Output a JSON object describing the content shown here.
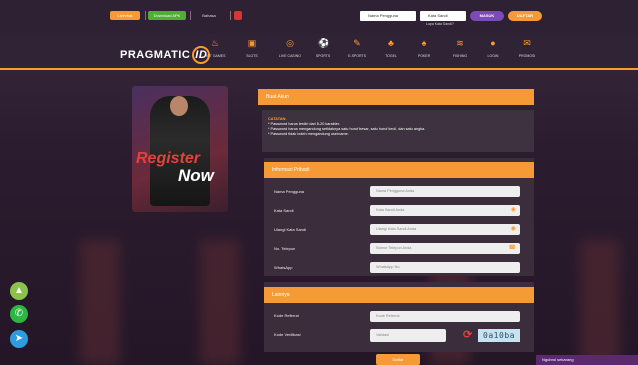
{
  "header": {
    "btn_one": "Livechat",
    "btn_two": "Download APK",
    "lang_label": "Bahasa",
    "username_placeholder": "Nama Pengguna",
    "password_placeholder": "Kata Sandi",
    "forgot_label": "Lupa Kata Sandi?",
    "login_label": "MASUK",
    "register_label": "DAFTAR"
  },
  "brand": {
    "name": "PRAGMATIC",
    "badge": "ID"
  },
  "nav": [
    {
      "label": "HOT GAMES",
      "icon": "fire-icon"
    },
    {
      "label": "SLOTS",
      "icon": "slot-icon"
    },
    {
      "label": "LIVE CASINO",
      "icon": "casino-icon"
    },
    {
      "label": "SPORTS",
      "icon": "ball-icon"
    },
    {
      "label": "E-SPORTS",
      "icon": "esports-icon"
    },
    {
      "label": "TOGEL",
      "icon": "togel-icon"
    },
    {
      "label": "POKER",
      "icon": "poker-icon"
    },
    {
      "label": "FISHING",
      "icon": "fish-icon"
    },
    {
      "label": "LOGIN",
      "icon": "login-icon"
    },
    {
      "label": "PROMOSI",
      "icon": "gift-icon"
    }
  ],
  "banner": {
    "line1": "Register",
    "line2": "Now"
  },
  "form": {
    "title": "Buat Akun",
    "notes_title": "CATATAN:",
    "notes": [
      "* Password harus terdiri dari 8-20 karakter.",
      "* Password harus mengandung setidaknya satu huruf besar, satu huruf kecil, dan satu angka.",
      "* Password tidak boleh mengandung username."
    ],
    "personal_title": "Informasi Pribadi",
    "fields": [
      {
        "label": "Nama Pengguna",
        "placeholder": "Nama Pengguna Anda",
        "icon": ""
      },
      {
        "label": "Kata Sandi",
        "placeholder": "Kata Sandi Anda",
        "icon": "eye-icon"
      },
      {
        "label": "Ulangi Kata Sandi",
        "placeholder": "Ulangi Kata Sandi Anda",
        "icon": "eye-icon"
      },
      {
        "label": "No. Telepon",
        "placeholder": "Nomor Telepon Anda",
        "icon": "phone-icon"
      },
      {
        "label": "WhatsApp",
        "placeholder": "WhatsApp No.",
        "icon": ""
      }
    ],
    "other_title": "Lainnya",
    "referral_label": "Kode Referral",
    "referral_placeholder": "Kode Referral",
    "verify_label": "Kode Verifikasi",
    "verify_placeholder": "Validasi",
    "captcha_text": "0a10ba",
    "submit_label": "Daftar"
  },
  "chat_label": "Ngobrol sekarang",
  "colors": {
    "accent": "#f59a35",
    "page_bg": "#2a1b2e"
  }
}
